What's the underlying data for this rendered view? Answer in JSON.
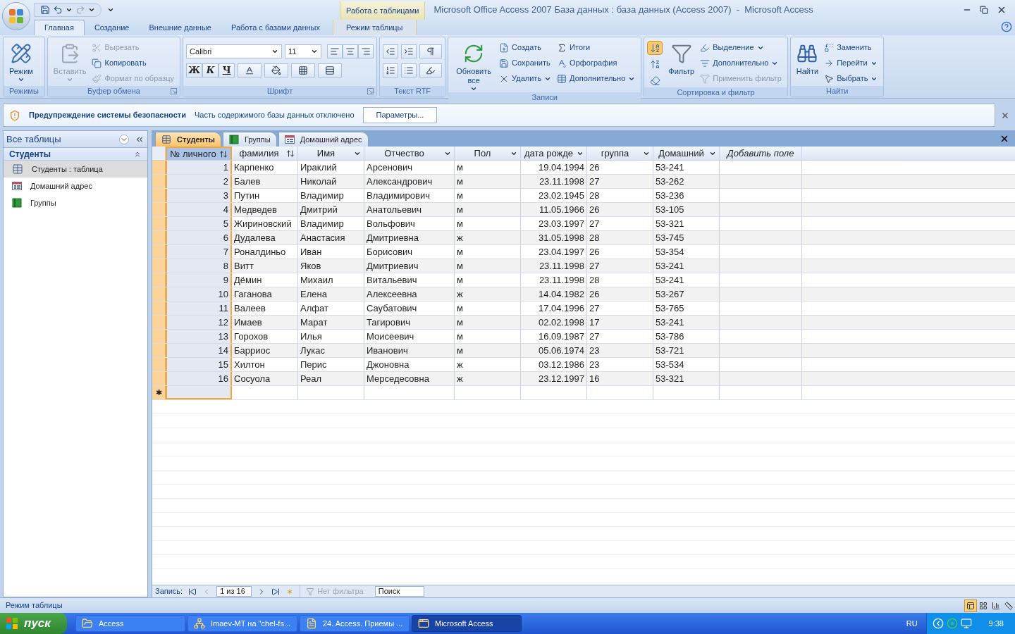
{
  "title_bar": {
    "context_label": "Работа с таблицами",
    "title": "Microsoft Office Access 2007 База данных : база данных (Access 2007)  -  Microsoft Access"
  },
  "ribbon_tabs": [
    {
      "label": "Главная",
      "selected": true,
      "contextual": false
    },
    {
      "label": "Создание",
      "selected": false,
      "contextual": false
    },
    {
      "label": "Внешние данные",
      "selected": false,
      "contextual": false
    },
    {
      "label": "Работа с базами данных",
      "selected": false,
      "contextual": false
    },
    {
      "label": "Режим таблицы",
      "selected": false,
      "contextual": true
    }
  ],
  "ribbon_groups": [
    {
      "label": "Режимы",
      "kind": "buttons",
      "launcher": false,
      "items": [
        {
          "kind": "large",
          "label": "Режим",
          "dropdown": true,
          "disabled": false
        }
      ]
    },
    {
      "label": "Буфер обмена",
      "kind": "buttons",
      "launcher": true,
      "items": [
        {
          "kind": "large",
          "label": "Вставить",
          "dropdown": true,
          "disabled": true
        },
        {
          "kind": "small",
          "label": "Вырезать",
          "dropdown": false,
          "disabled": true
        },
        {
          "kind": "small",
          "label": "Копировать",
          "dropdown": false,
          "disabled": false
        },
        {
          "kind": "small",
          "label": "Формат по образцу",
          "dropdown": false,
          "disabled": true
        }
      ]
    },
    {
      "label": "Шрифт",
      "kind": "font",
      "launcher": true,
      "font": "Calibri",
      "size": "11",
      "format_buttons": [
        "Ж",
        "К",
        "Ч"
      ]
    },
    {
      "label": "Текст RTF",
      "kind": "rtf",
      "launcher": false
    },
    {
      "label": "Записи",
      "kind": "buttons",
      "launcher": false,
      "items": [
        {
          "kind": "large",
          "label": "Обновить все",
          "dropdown": true,
          "disabled": false
        },
        {
          "kind": "small",
          "label": "Создать",
          "dropdown": false,
          "disabled": false
        },
        {
          "kind": "small",
          "label": "Сохранить",
          "dropdown": false,
          "disabled": false
        },
        {
          "kind": "small",
          "label": "Удалить",
          "dropdown": true,
          "disabled": false
        },
        {
          "kind": "small",
          "label": "Итоги",
          "dropdown": false,
          "disabled": false
        },
        {
          "kind": "small",
          "label": "Орфография",
          "dropdown": false,
          "disabled": false
        },
        {
          "kind": "small",
          "label": "Дополнительно",
          "dropdown": true,
          "disabled": false
        }
      ]
    },
    {
      "label": "Сортировка и фильтр",
      "kind": "buttons",
      "launcher": false,
      "items": [
        {
          "kind": "icon",
          "selected": true
        },
        {
          "kind": "icon",
          "selected": false
        },
        {
          "kind": "icon",
          "selected": false
        },
        {
          "kind": "large",
          "label": "Фильтр",
          "dropdown": false,
          "disabled": false
        },
        {
          "kind": "small",
          "label": "Выделение",
          "dropdown": true,
          "disabled": false
        },
        {
          "kind": "small",
          "label": "Дополнительно",
          "dropdown": true,
          "disabled": false
        },
        {
          "kind": "small",
          "label": "Применить фильтр",
          "dropdown": false,
          "disabled": true
        }
      ]
    },
    {
      "label": "Найти",
      "kind": "buttons",
      "launcher": false,
      "items": [
        {
          "kind": "large",
          "label": "Найти",
          "dropdown": false,
          "disabled": false
        },
        {
          "kind": "small",
          "label": "Заменить",
          "dropdown": false,
          "disabled": false
        },
        {
          "kind": "small",
          "label": "Перейти",
          "dropdown": true,
          "disabled": false
        },
        {
          "kind": "small",
          "label": "Выбрать",
          "dropdown": true,
          "disabled": false
        }
      ]
    }
  ],
  "security_bar": {
    "title": "Предупреждение системы безопасности",
    "message": "Часть содержимого базы данных отключено",
    "button": "Параметры..."
  },
  "nav_pane": {
    "header": "Все таблицы",
    "group": "Студенты",
    "items": [
      {
        "label": "Студенты : таблица",
        "selected": true
      },
      {
        "label": "Домашний адрес",
        "selected": false
      },
      {
        "label": "Группы",
        "selected": false
      }
    ]
  },
  "doc_tabs": [
    {
      "label": "Студенты",
      "selected": true
    },
    {
      "label": "Группы",
      "selected": false
    },
    {
      "label": "Домашний адрес",
      "selected": false
    }
  ],
  "table": {
    "columns": [
      {
        "label": "№ личного",
        "kind": "number",
        "sorted": true,
        "selected": true
      },
      {
        "label": "фамилия",
        "kind": "text",
        "sorted": true,
        "selected": false
      },
      {
        "label": "Имя",
        "kind": "text",
        "sorted": false,
        "selected": false
      },
      {
        "label": "Отчество",
        "kind": "text",
        "sorted": false,
        "selected": false
      },
      {
        "label": "Пол",
        "kind": "text",
        "sorted": false,
        "selected": false
      },
      {
        "label": "дата рожде",
        "kind": "date",
        "sorted": false,
        "selected": false
      },
      {
        "label": "группа",
        "kind": "text",
        "sorted": false,
        "selected": false
      },
      {
        "label": "Домашний",
        "kind": "text",
        "sorted": false,
        "selected": false
      },
      {
        "label": "Добавить поле",
        "kind": "add",
        "selected": false
      }
    ],
    "rows": [
      [
        "1",
        "Карпенко",
        "Ираклий",
        "Арсенович",
        "м",
        "19.04.1994",
        "26",
        "53-241"
      ],
      [
        "2",
        "Балев",
        "Николай",
        "Александрович",
        "м",
        "23.11.1998",
        "27",
        "53-262"
      ],
      [
        "3",
        "Путин",
        "Владимир",
        "Владимирович",
        "м",
        "23.02.1945",
        "28",
        "53-236"
      ],
      [
        "4",
        "Медведев",
        "Дмитрий",
        "Анатольевич",
        "м",
        "11.05.1966",
        "26",
        "53-105"
      ],
      [
        "5",
        "Жириновский",
        "Владимир",
        "Вольфович",
        "м",
        "23.03.1997",
        "27",
        "53-321"
      ],
      [
        "6",
        "Дудалева",
        "Анастасия",
        "Дмитриевна",
        "ж",
        "31.05.1998",
        "28",
        "53-745"
      ],
      [
        "7",
        "Роналдиньо",
        "Иван",
        "Борисович",
        "м",
        "23.04.1997",
        "26",
        "53-354"
      ],
      [
        "8",
        "Витт",
        "Яков",
        "Дмитриевич",
        "м",
        "23.11.1998",
        "27",
        "53-241"
      ],
      [
        "9",
        "Дёмин",
        "Михаил",
        "Витальевич",
        "м",
        "23.11.1998",
        "28",
        "53-241"
      ],
      [
        "10",
        "Гаганова",
        "Елена",
        "Алексеевна",
        "ж",
        "14.04.1982",
        "26",
        "53-267"
      ],
      [
        "11",
        "Валеев",
        "Алфат",
        "Саубатович",
        "м",
        "17.04.1996",
        "27",
        "53-765"
      ],
      [
        "12",
        "Имаев",
        "Марат",
        "Тагирович",
        "м",
        "02.02.1998",
        "17",
        "53-241"
      ],
      [
        "13",
        "Горохов",
        "Илья",
        "Моисеевич",
        "м",
        "16.09.1987",
        "27",
        "53-786"
      ],
      [
        "14",
        "Барриос",
        "Лукас",
        "Иванович",
        "м",
        "05.06.1974",
        "23",
        "53-721"
      ],
      [
        "15",
        "Хилтон",
        "Перис",
        "Джоновна",
        "ж",
        "03.12.1986",
        "23",
        "53-534"
      ],
      [
        "16",
        "Сосуола",
        "Реал",
        "Мерседесовна",
        "ж",
        "23.12.1997",
        "16",
        "53-321"
      ]
    ],
    "new_row_marker": "✱"
  },
  "record_nav": {
    "label": "Запись:",
    "position": "1 из 16",
    "filter": "Нет фильтра",
    "search": "Поиск"
  },
  "status_bar": {
    "text": "Режим таблицы",
    "view_buttons": [
      {
        "selected": true
      },
      {
        "selected": false
      },
      {
        "selected": false
      },
      {
        "selected": false
      }
    ]
  },
  "taskbar": {
    "start": "пуск",
    "tasks": [
      {
        "label": "Access",
        "selected": false
      },
      {
        "label": "Imaev-MT на \"chel-fs...",
        "selected": false
      },
      {
        "label": "24. Access. Приемы ...",
        "selected": false
      },
      {
        "label": "Microsoft Access",
        "selected": true
      }
    ],
    "language": "RU",
    "clock": "9:38"
  }
}
